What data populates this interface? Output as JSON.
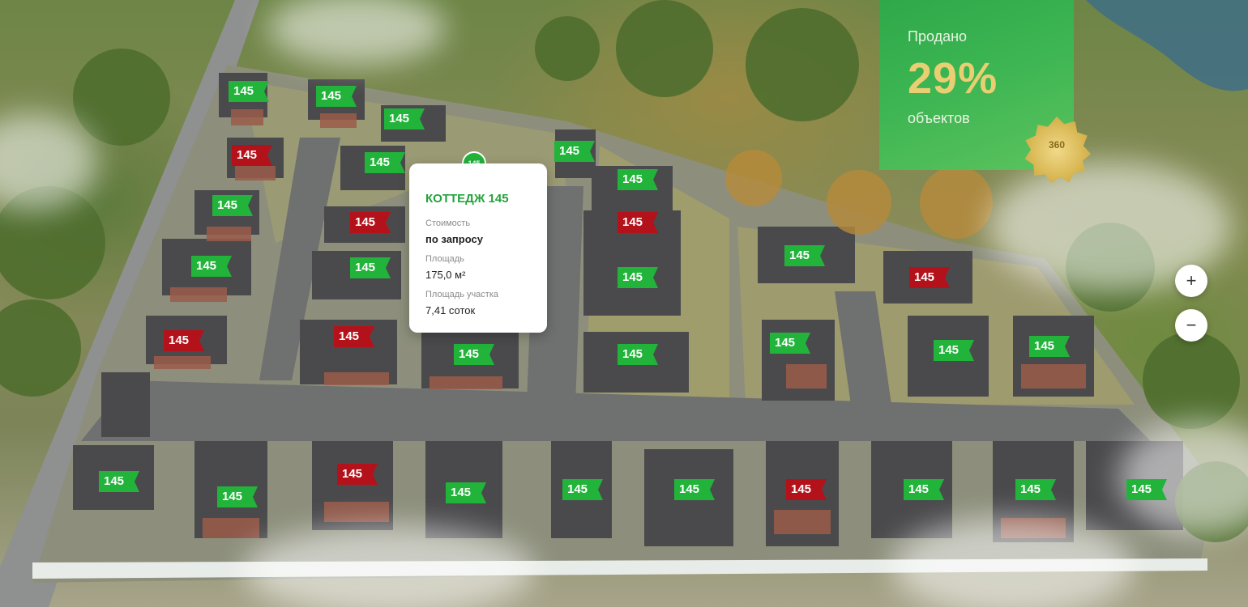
{
  "map": {
    "markers": [
      {
        "label": "145",
        "status": "available"
      },
      {
        "label": "145",
        "status": "available"
      },
      {
        "label": "145",
        "status": "available"
      },
      {
        "label": "145",
        "status": "sold"
      },
      {
        "label": "145",
        "status": "available"
      },
      {
        "label": "145",
        "status": "available"
      },
      {
        "label": "145",
        "status": "available"
      },
      {
        "label": "145",
        "status": "sold"
      },
      {
        "label": "145",
        "status": "available"
      },
      {
        "label": "145",
        "status": "sold"
      },
      {
        "label": "145",
        "status": "available"
      },
      {
        "label": "145",
        "status": "available"
      },
      {
        "label": "145",
        "status": "sold"
      },
      {
        "label": "145",
        "status": "available"
      },
      {
        "label": "145",
        "status": "sold"
      },
      {
        "label": "145",
        "status": "sold"
      },
      {
        "label": "145",
        "status": "available"
      },
      {
        "label": "145",
        "status": "available"
      },
      {
        "label": "145",
        "status": "available"
      },
      {
        "label": "145",
        "status": "available"
      },
      {
        "label": "145",
        "status": "available"
      },
      {
        "label": "145",
        "status": "available"
      },
      {
        "label": "145",
        "status": "sold"
      },
      {
        "label": "145",
        "status": "available"
      },
      {
        "label": "145",
        "status": "available"
      },
      {
        "label": "145",
        "status": "available"
      },
      {
        "label": "145",
        "status": "available"
      },
      {
        "label": "145",
        "status": "sold"
      },
      {
        "label": "145",
        "status": "available"
      },
      {
        "label": "145",
        "status": "available"
      },
      {
        "label": "145",
        "status": "available"
      },
      {
        "label": "145",
        "status": "sold"
      },
      {
        "label": "145",
        "status": "available"
      },
      {
        "label": "145",
        "status": "available"
      },
      {
        "label": "145",
        "status": "available"
      }
    ]
  },
  "tooltip": {
    "pin_label": "145",
    "title": "КОТТЕДЖ 145",
    "price_label": "Стоимость",
    "price_value": "по запросу",
    "area_label": "Площадь",
    "area_value": "175,0 м²",
    "plot_label": "Площадь участка",
    "plot_value": "7,41 соток"
  },
  "sold_panel": {
    "title": "Продано",
    "percent": "29%",
    "subtitle": "объектов",
    "badge_label": "360"
  },
  "zoom": {
    "in_label": "+",
    "out_label": "−"
  },
  "colors": {
    "available": "#22b33a",
    "sold": "#b3121b",
    "accent_gold": "#e9cf72"
  }
}
